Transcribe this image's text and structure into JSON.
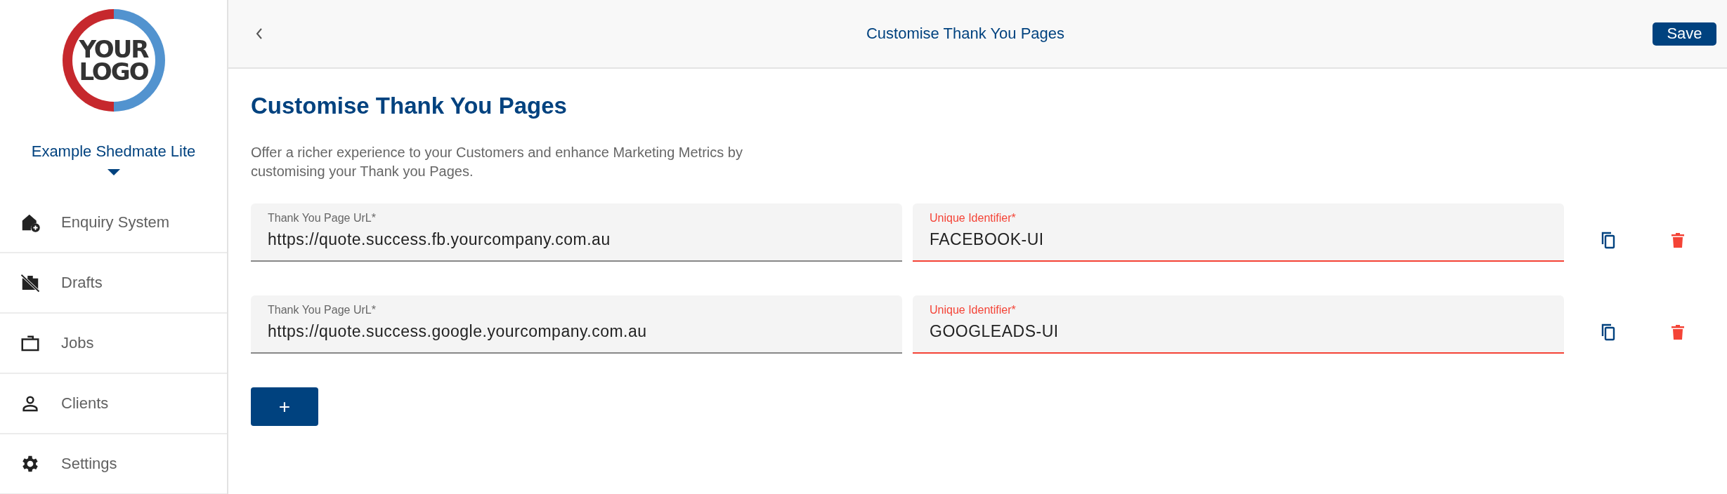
{
  "sidebar": {
    "logo": {
      "lines": [
        "YOUR",
        "LOGO"
      ]
    },
    "company": "Example Shedmate Lite",
    "items": [
      {
        "label": "Enquiry System"
      },
      {
        "label": "Drafts"
      },
      {
        "label": "Jobs"
      },
      {
        "label": "Clients"
      },
      {
        "label": "Settings"
      }
    ]
  },
  "header": {
    "title": "Customise Thank You Pages",
    "save": "Save"
  },
  "page": {
    "heading": "Customise Thank You Pages",
    "description": "Offer a richer experience to your Customers and enhance Marketing Metrics by customising your Thank you Pages.",
    "rows": [
      {
        "url": {
          "label": "Thank You Page UrL*",
          "value": "https://quote.success.fb.yourcompany.com.au",
          "invalid": false
        },
        "identifier": {
          "label": "Unique Identifier*",
          "value": "FACEBOOK-UI",
          "invalid": true
        }
      },
      {
        "url": {
          "label": "Thank You Page UrL*",
          "value": "https://quote.success.google.yourcompany.com.au",
          "invalid": false
        },
        "identifier": {
          "label": "Unique Identifier*",
          "value": "GOOGLEADS-UI",
          "invalid": true
        }
      }
    ],
    "add": "+"
  }
}
